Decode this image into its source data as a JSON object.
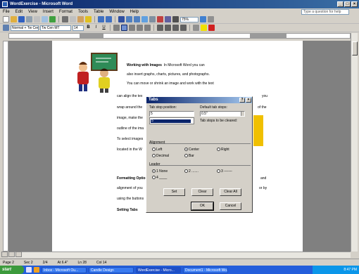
{
  "window": {
    "title": "WordExercise - Microsoft Word"
  },
  "menu": [
    "File",
    "Edit",
    "View",
    "Insert",
    "Format",
    "Tools",
    "Table",
    "Window",
    "Help"
  ],
  "help_placeholder": "Type a question for help",
  "format_toolbar": {
    "style": "Normal + Tw Cen...",
    "font": "Tw Cen MT",
    "size": "14",
    "zoom": "75%"
  },
  "document": {
    "heading": "Working with Images",
    "line1_rest": "In Microsoft Word you can",
    "line2": "also insert graphs, charts, pictures, and photographs.",
    "line3": "You can move or shrink an image and work with the text",
    "line4_left": "can align the tex",
    "line4_right": "you",
    "line5_left": "wrap around the",
    "line5_right": "of the",
    "line6_left": "image, make the",
    "line7_left": "outline of the ima",
    "line8_left": "To select images",
    "line9_left": "located in the W",
    "formatting_heading": "Formatting Optio",
    "line10_right": "and",
    "line11_left": "alignment of you",
    "line11_right": "or by",
    "line12_left": "using the buttons",
    "setting_tabs": "Setting Tabs"
  },
  "dialog": {
    "title": "Tabs",
    "tab_stop_position_label": "Tab stop position:",
    "tab_stop_value": "5",
    "list_items": [
      "5"
    ],
    "default_tab_stops_label": "Default tab stops:",
    "default_tab_value": "0.5\"",
    "cleared_label": "Tab stops to be cleared:",
    "alignment_label": "Alignment",
    "alignment_options": [
      "Left",
      "Center",
      "Right",
      "Decimal",
      "Bar"
    ],
    "alignment_selected": "Center",
    "leader_label": "Leader",
    "leader_options": [
      "1 None",
      "2 .......",
      "3 -------",
      "4 ____"
    ],
    "leader_selected": "1 None",
    "buttons": {
      "set": "Set",
      "clear": "Clear",
      "clear_all": "Clear All",
      "ok": "OK",
      "cancel": "Cancel"
    }
  },
  "status": {
    "page": "Page 2",
    "sec": "Sec 2",
    "pages": "2/4",
    "at": "At 6.4\"",
    "ln": "Ln 28",
    "col": "Col 14"
  },
  "taskbar": {
    "start": "start",
    "tasks": [
      "Inbox - Microsoft Ou...",
      "Candle Design",
      "WordExercise - Micro...",
      "Document1 - Microsoft Wo..."
    ],
    "tray": "8:47 PM"
  },
  "colors": {
    "title_blue": "#0a246a",
    "taskbar_blue": "#245edb",
    "highlight": "#f0c000"
  },
  "icons": [
    "word-app-icon",
    "new-icon",
    "open-icon",
    "save-icon",
    "print-icon",
    "bold-icon",
    "italic-icon",
    "underline-icon",
    "align-left-icon",
    "align-center-icon",
    "bullets-icon",
    "font-color-icon"
  ]
}
